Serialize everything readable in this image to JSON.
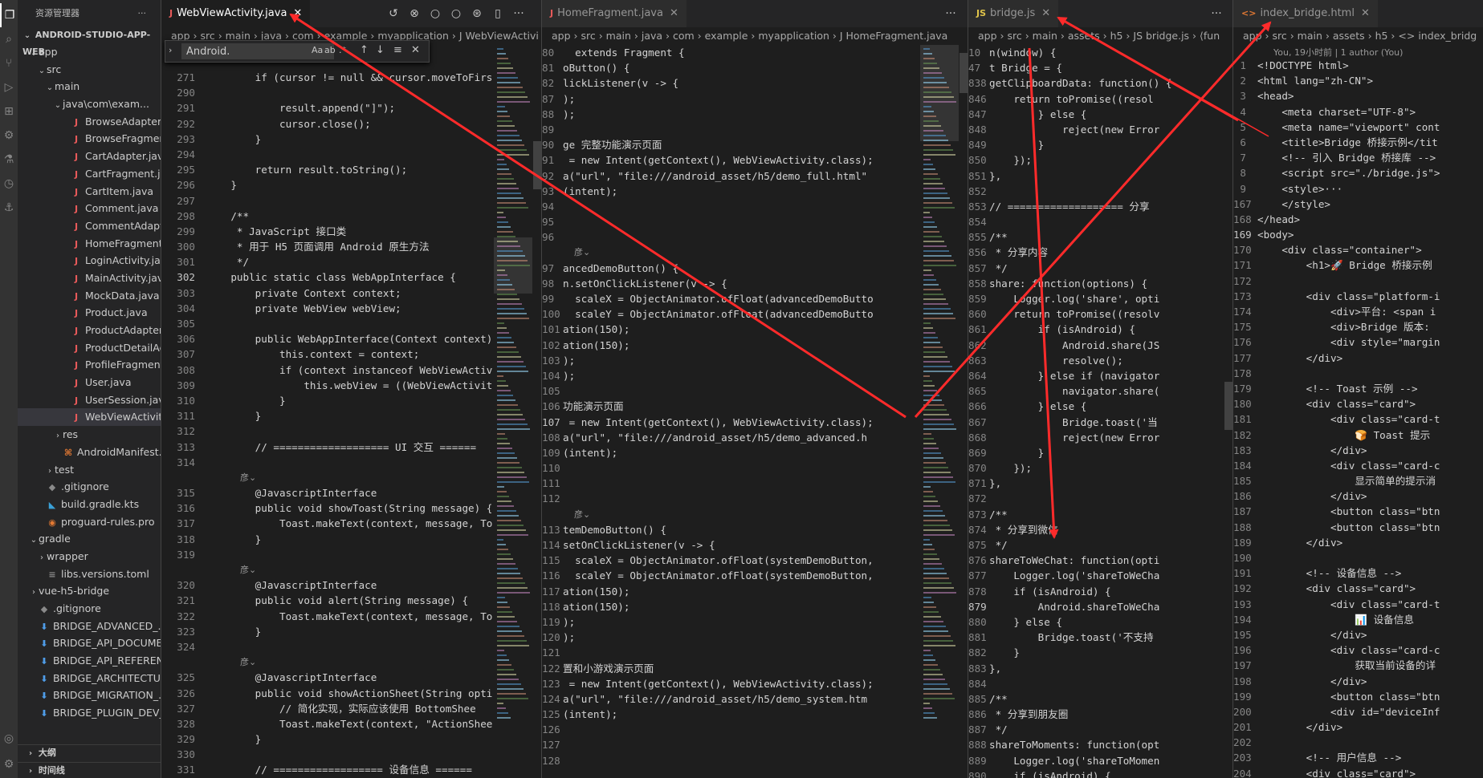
{
  "explorer": {
    "title": "资源管理器",
    "more": "···",
    "root": "ANDROID-STUDIO-APP-WEB",
    "items": [
      {
        "depth": 1,
        "chev": "⌄",
        "icon": "",
        "label": "app"
      },
      {
        "depth": 2,
        "chev": "⌄",
        "icon": "",
        "label": "src"
      },
      {
        "depth": 3,
        "chev": "⌄",
        "icon": "",
        "label": "main"
      },
      {
        "depth": 4,
        "chev": "⌄",
        "icon": "",
        "label": "java\\com\\exam..."
      },
      {
        "depth": 5,
        "chev": "",
        "icon": "J",
        "label": "BrowseAdapter.j..."
      },
      {
        "depth": 5,
        "chev": "",
        "icon": "J",
        "label": "BrowseFragmen..."
      },
      {
        "depth": 5,
        "chev": "",
        "icon": "J",
        "label": "CartAdapter.java"
      },
      {
        "depth": 5,
        "chev": "",
        "icon": "J",
        "label": "CartFragment.java"
      },
      {
        "depth": 5,
        "chev": "",
        "icon": "J",
        "label": "CartItem.java"
      },
      {
        "depth": 5,
        "chev": "",
        "icon": "J",
        "label": "Comment.java"
      },
      {
        "depth": 5,
        "chev": "",
        "icon": "J",
        "label": "CommentAdapt..."
      },
      {
        "depth": 5,
        "chev": "",
        "icon": "J",
        "label": "HomeFragment...."
      },
      {
        "depth": 5,
        "chev": "",
        "icon": "J",
        "label": "LoginActivity.java"
      },
      {
        "depth": 5,
        "chev": "",
        "icon": "J",
        "label": "MainActivity.java"
      },
      {
        "depth": 5,
        "chev": "",
        "icon": "J",
        "label": "MockData.java"
      },
      {
        "depth": 5,
        "chev": "",
        "icon": "J",
        "label": "Product.java"
      },
      {
        "depth": 5,
        "chev": "",
        "icon": "J",
        "label": "ProductAdapter...."
      },
      {
        "depth": 5,
        "chev": "",
        "icon": "J",
        "label": "ProductDetailAc..."
      },
      {
        "depth": 5,
        "chev": "",
        "icon": "J",
        "label": "ProfileFragment...."
      },
      {
        "depth": 5,
        "chev": "",
        "icon": "J",
        "label": "User.java"
      },
      {
        "depth": 5,
        "chev": "",
        "icon": "J",
        "label": "UserSession.java"
      },
      {
        "depth": 5,
        "chev": "",
        "icon": "J",
        "label": "WebViewActivit...",
        "selected": true
      },
      {
        "depth": 4,
        "chev": "›",
        "icon": "",
        "label": "res"
      },
      {
        "depth": 4,
        "chev": "",
        "icon": "⌘",
        "label": "AndroidManifest..."
      },
      {
        "depth": 3,
        "chev": "›",
        "icon": "",
        "label": "test"
      },
      {
        "depth": 2,
        "chev": "",
        "icon": "◆",
        "label": ".gitignore"
      },
      {
        "depth": 2,
        "chev": "",
        "icon": "◣",
        "label": "build.gradle.kts"
      },
      {
        "depth": 2,
        "chev": "",
        "icon": "◉",
        "label": "proguard-rules.pro"
      },
      {
        "depth": 1,
        "chev": "⌄",
        "icon": "",
        "label": "gradle"
      },
      {
        "depth": 2,
        "chev": "›",
        "icon": "",
        "label": "wrapper"
      },
      {
        "depth": 2,
        "chev": "",
        "icon": "≡",
        "label": "libs.versions.toml"
      },
      {
        "depth": 1,
        "chev": "›",
        "icon": "",
        "label": "vue-h5-bridge"
      },
      {
        "depth": 1,
        "chev": "",
        "icon": "◆",
        "label": ".gitignore"
      },
      {
        "depth": 1,
        "chev": "",
        "icon": "⬇",
        "label": "BRIDGE_ADVANCED_..."
      },
      {
        "depth": 1,
        "chev": "",
        "icon": "⬇",
        "label": "BRIDGE_API_DOCUME..."
      },
      {
        "depth": 1,
        "chev": "",
        "icon": "⬇",
        "label": "BRIDGE_API_REFEREN..."
      },
      {
        "depth": 1,
        "chev": "",
        "icon": "⬇",
        "label": "BRIDGE_ARCHITECTU..."
      },
      {
        "depth": 1,
        "chev": "",
        "icon": "⬇",
        "label": "BRIDGE_MIGRATION_..."
      },
      {
        "depth": 1,
        "chev": "",
        "icon": "⬇",
        "label": "BRIDGE_PLUGIN_DEV_..."
      }
    ],
    "outline": "大纲",
    "timeline": "时间线"
  },
  "editor1": {
    "tab_icon": "J",
    "tab": "WebViewActivity.java",
    "close": "✕",
    "actions": [
      "↺",
      "⊗",
      "○",
      "○",
      "⊛",
      "▯",
      "···"
    ],
    "breadcrumb": "app  ›  src  ›  main  ›  java  ›  com  ›  example  ›  myapplication  ›  J  WebViewActivi",
    "find_value": "Android.",
    "find_opts": [
      "Aa",
      "ab",
      ".*"
    ],
    "find_buttons": [
      "↑",
      "↓",
      "≡",
      "✕"
    ],
    "lines": [
      {
        "n": "271",
        "t": "        if (cursor != null && cursor.moveToFirs"
      },
      {
        "n": "290",
        "t": ""
      },
      {
        "n": "291",
        "t": "            result.append(\"]\");"
      },
      {
        "n": "292",
        "t": "            cursor.close();"
      },
      {
        "n": "293",
        "t": "        }"
      },
      {
        "n": "294",
        "t": ""
      },
      {
        "n": "295",
        "t": "        return result.toString();"
      },
      {
        "n": "296",
        "t": "    }"
      },
      {
        "n": "297",
        "t": ""
      },
      {
        "n": "298",
        "t": "    /**"
      },
      {
        "n": "299",
        "t": "     * JavaScript 接口类"
      },
      {
        "n": "300",
        "t": "     * 用于 H5 页面调用 Android 原生方法"
      },
      {
        "n": "301",
        "t": "     */"
      },
      {
        "n": "302",
        "t": "    public static class WebAppInterface {",
        "cur": true
      },
      {
        "n": "303",
        "t": "        private Context context;"
      },
      {
        "n": "304",
        "t": "        private WebView webView;"
      },
      {
        "n": "305",
        "t": ""
      },
      {
        "n": "306",
        "t": "        public WebAppInterface(Context context)"
      },
      {
        "n": "307",
        "t": "            this.context = context;"
      },
      {
        "n": "308",
        "t": "            if (context instanceof WebViewActiv"
      },
      {
        "n": "309",
        "t": "                this.webView = ((WebViewActivit"
      },
      {
        "n": "310",
        "t": "            }"
      },
      {
        "n": "311",
        "t": "        }"
      },
      {
        "n": "312",
        "t": ""
      },
      {
        "n": "313",
        "t": "        // =================== UI 交互 ======"
      },
      {
        "n": "314",
        "t": ""
      },
      {
        "n": "",
        "lens": "        彦⌄"
      },
      {
        "n": "315",
        "t": "        @JavascriptInterface"
      },
      {
        "n": "316",
        "t": "        public void showToast(String message) {"
      },
      {
        "n": "317",
        "t": "            Toast.makeText(context, message, To"
      },
      {
        "n": "318",
        "t": "        }"
      },
      {
        "n": "319",
        "t": ""
      },
      {
        "n": "",
        "lens": "        彦⌄"
      },
      {
        "n": "320",
        "t": "        @JavascriptInterface"
      },
      {
        "n": "321",
        "t": "        public void alert(String message) {"
      },
      {
        "n": "322",
        "t": "            Toast.makeText(context, message, To"
      },
      {
        "n": "323",
        "t": "        }"
      },
      {
        "n": "324",
        "t": ""
      },
      {
        "n": "",
        "lens": "        彦⌄"
      },
      {
        "n": "325",
        "t": "        @JavascriptInterface"
      },
      {
        "n": "326",
        "t": "        public void showActionSheet(String opti"
      },
      {
        "n": "327",
        "t": "            // 简化实现，实际应该使用 BottomShee"
      },
      {
        "n": "328",
        "t": "            Toast.makeText(context, \"ActionShee"
      },
      {
        "n": "329",
        "t": "        }"
      },
      {
        "n": "330",
        "t": ""
      },
      {
        "n": "331",
        "t": "        // ================== 设备信息 ======"
      },
      {
        "n": "332",
        "t": ""
      }
    ]
  },
  "editor2": {
    "tab_icon": "J",
    "tab": "HomeFragment.java",
    "close": "✕",
    "more": "···",
    "breadcrumb": "app  ›  src  ›  main  ›  java  ›  com  ›  example  ›  myapplication  ›  J  HomeFragment.java",
    "lines": [
      {
        "n": "80",
        "t": "  extends Fragment {"
      },
      {
        "n": "81",
        "t": "oButton() {"
      },
      {
        "n": "82",
        "t": "lickListener(v -> {"
      },
      {
        "n": "87",
        "t": ");"
      },
      {
        "n": "88",
        "t": ");"
      },
      {
        "n": "89",
        "t": ""
      },
      {
        "n": "90",
        "t": "ge 完整功能演示页面"
      },
      {
        "n": "91",
        "t": " = new Intent(getContext(), WebViewActivity.class);"
      },
      {
        "n": "92",
        "t": "a(\"url\", \"file:///android_asset/h5/demo_full.html\""
      },
      {
        "n": "93",
        "t": "(intent);"
      },
      {
        "n": "94",
        "t": ""
      },
      {
        "n": "95",
        "t": ""
      },
      {
        "n": "96",
        "t": ""
      },
      {
        "n": "",
        "lens": "彦⌄"
      },
      {
        "n": "97",
        "t": "ancedDemoButton() {"
      },
      {
        "n": "98",
        "t": "n.setOnClickListener(v -> {"
      },
      {
        "n": "99",
        "t": "  scaleX = ObjectAnimator.ofFloat(advancedDemoButto"
      },
      {
        "n": "100",
        "t": "  scaleY = ObjectAnimator.ofFloat(advancedDemoButto"
      },
      {
        "n": "101",
        "t": "ation(150);"
      },
      {
        "n": "102",
        "t": "ation(150);"
      },
      {
        "n": "103",
        "t": ");"
      },
      {
        "n": "104",
        "t": ");"
      },
      {
        "n": "105",
        "t": ""
      },
      {
        "n": "106",
        "t": "功能演示页面"
      },
      {
        "n": "107",
        "t": " = new Intent(getContext(), WebViewActivity.class);",
        "cur": true
      },
      {
        "n": "108",
        "t": "a(\"url\", \"file:///android_asset/h5/demo_advanced.h"
      },
      {
        "n": "109",
        "t": "(intent);"
      },
      {
        "n": "110",
        "t": ""
      },
      {
        "n": "111",
        "t": ""
      },
      {
        "n": "112",
        "t": ""
      },
      {
        "n": "",
        "lens": "彦⌄"
      },
      {
        "n": "113",
        "t": "temDemoButton() {"
      },
      {
        "n": "114",
        "t": "setOnClickListener(v -> {"
      },
      {
        "n": "115",
        "t": "  scaleX = ObjectAnimator.ofFloat(systemDemoButton,"
      },
      {
        "n": "116",
        "t": "  scaleY = ObjectAnimator.ofFloat(systemDemoButton,"
      },
      {
        "n": "117",
        "t": "ation(150);"
      },
      {
        "n": "118",
        "t": "ation(150);"
      },
      {
        "n": "119",
        "t": ");"
      },
      {
        "n": "120",
        "t": ");"
      },
      {
        "n": "121",
        "t": ""
      },
      {
        "n": "122",
        "t": "置和小游戏演示页面"
      },
      {
        "n": "123",
        "t": " = new Intent(getContext(), WebViewActivity.class);"
      },
      {
        "n": "124",
        "t": "a(\"url\", \"file:///android_asset/h5/demo_system.htm"
      },
      {
        "n": "125",
        "t": "(intent);"
      },
      {
        "n": "126",
        "t": ""
      },
      {
        "n": "127",
        "t": ""
      },
      {
        "n": "128",
        "t": ""
      }
    ]
  },
  "editor3": {
    "tab_icon": "JS",
    "tab": "bridge.js",
    "close": "✕",
    "more": "···",
    "breadcrumb": "app  ›  src  ›  main  ›  assets  ›  h5  ›  JS  bridge.js  ›  ⟨fun",
    "lines": [
      {
        "n": "10",
        "t": "n(window) {"
      },
      {
        "n": "47",
        "t": "t Bridge = {"
      },
      {
        "n": "838",
        "t": "getClipboardData: function() {"
      },
      {
        "n": "846",
        "t": "    return toPromise((resol"
      },
      {
        "n": "847",
        "t": "        } else {"
      },
      {
        "n": "848",
        "t": "            reject(new Error"
      },
      {
        "n": "849",
        "t": "        }"
      },
      {
        "n": "850",
        "t": "    });"
      },
      {
        "n": "851",
        "t": "},"
      },
      {
        "n": "852",
        "t": ""
      },
      {
        "n": "853",
        "t": "// =================== 分享"
      },
      {
        "n": "854",
        "t": ""
      },
      {
        "n": "855",
        "t": "/**"
      },
      {
        "n": "856",
        "t": " * 分享内容"
      },
      {
        "n": "857",
        "t": " */"
      },
      {
        "n": "858",
        "t": "share: function(options) {"
      },
      {
        "n": "859",
        "t": "    Logger.log('share', opti"
      },
      {
        "n": "860",
        "t": "    return toPromise((resolv"
      },
      {
        "n": "861",
        "t": "        if (isAndroid) {"
      },
      {
        "n": "862",
        "t": "            Android.share(JS"
      },
      {
        "n": "863",
        "t": "            resolve();"
      },
      {
        "n": "864",
        "t": "        } else if (navigator"
      },
      {
        "n": "865",
        "t": "            navigator.share("
      },
      {
        "n": "866",
        "t": "        } else {"
      },
      {
        "n": "867",
        "t": "            Bridge.toast('当"
      },
      {
        "n": "868",
        "t": "            reject(new Error"
      },
      {
        "n": "869",
        "t": "        }"
      },
      {
        "n": "870",
        "t": "    });"
      },
      {
        "n": "871",
        "t": "},"
      },
      {
        "n": "872",
        "t": ""
      },
      {
        "n": "873",
        "t": "/**"
      },
      {
        "n": "874",
        "t": " * 分享到微信"
      },
      {
        "n": "875",
        "t": " */"
      },
      {
        "n": "876",
        "t": "shareToWeChat: function(opti"
      },
      {
        "n": "877",
        "t": "    Logger.log('shareToWeCha"
      },
      {
        "n": "878",
        "t": "    if (isAndroid) {"
      },
      {
        "n": "879",
        "t": "        Android.shareToWeCha",
        "cur": true
      },
      {
        "n": "880",
        "t": "    } else {"
      },
      {
        "n": "881",
        "t": "        Bridge.toast('不支持"
      },
      {
        "n": "882",
        "t": "    }"
      },
      {
        "n": "883",
        "t": "},"
      },
      {
        "n": "884",
        "t": ""
      },
      {
        "n": "885",
        "t": "/**"
      },
      {
        "n": "886",
        "t": " * 分享到朋友圈"
      },
      {
        "n": "887",
        "t": " */"
      },
      {
        "n": "888",
        "t": "shareToMoments: function(opt"
      },
      {
        "n": "889",
        "t": "    Logger.log('shareToMomen"
      },
      {
        "n": "890",
        "t": "    if (isAndroid) {"
      }
    ]
  },
  "editor4": {
    "tab_icon": "<>",
    "tab": "index_bridge.html",
    "close": "✕",
    "breadcrumb": "app  ›  src  ›  main  ›  assets  ›  h5  ›  <>  index_bridg",
    "blame": "You, 19小时前 | 1 author (You)",
    "lines": [
      {
        "n": "1",
        "t": "<!DOCTYPE html>"
      },
      {
        "n": "2",
        "t": "<html lang=\"zh-CN\">"
      },
      {
        "n": "3",
        "t": "<head>"
      },
      {
        "n": "4",
        "t": "    <meta charset=\"UTF-8\">"
      },
      {
        "n": "5",
        "t": "    <meta name=\"viewport\" cont"
      },
      {
        "n": "6",
        "t": "    <title>Bridge 桥接示例</tit"
      },
      {
        "n": "7",
        "t": "    <!-- 引入 Bridge 桥接库 -->"
      },
      {
        "n": "8",
        "t": "    <script src=\"./bridge.js\">"
      },
      {
        "n": "9",
        "t": "    <style>···",
        "fold": true
      },
      {
        "n": "167",
        "t": "    </style>"
      },
      {
        "n": "168",
        "t": "</head>"
      },
      {
        "n": "169",
        "t": "<body>",
        "cur": true
      },
      {
        "n": "170",
        "t": "    <div class=\"container\">"
      },
      {
        "n": "171",
        "t": "        <h1>🚀 Bridge 桥接示例"
      },
      {
        "n": "172",
        "t": ""
      },
      {
        "n": "173",
        "t": "        <div class=\"platform-i"
      },
      {
        "n": "174",
        "t": "            <div>平台: <span i"
      },
      {
        "n": "175",
        "t": "            <div>Bridge 版本:"
      },
      {
        "n": "176",
        "t": "            <div style=\"margin"
      },
      {
        "n": "177",
        "t": "        </div>"
      },
      {
        "n": "178",
        "t": ""
      },
      {
        "n": "179",
        "t": "        <!-- Toast 示例 -->"
      },
      {
        "n": "180",
        "t": "        <div class=\"card\">"
      },
      {
        "n": "181",
        "t": "            <div class=\"card-t"
      },
      {
        "n": "182",
        "t": "                🍞 Toast 提示"
      },
      {
        "n": "183",
        "t": "            </div>"
      },
      {
        "n": "184",
        "t": "            <div class=\"card-c"
      },
      {
        "n": "185",
        "t": "                显示简单的提示消"
      },
      {
        "n": "186",
        "t": "            </div>"
      },
      {
        "n": "187",
        "t": "            <button class=\"btn"
      },
      {
        "n": "188",
        "t": "            <button class=\"btn"
      },
      {
        "n": "189",
        "t": "        </div>"
      },
      {
        "n": "190",
        "t": ""
      },
      {
        "n": "191",
        "t": "        <!-- 设备信息 -->"
      },
      {
        "n": "192",
        "t": "        <div class=\"card\">"
      },
      {
        "n": "193",
        "t": "            <div class=\"card-t"
      },
      {
        "n": "194",
        "t": "                📊 设备信息"
      },
      {
        "n": "195",
        "t": "            </div>"
      },
      {
        "n": "196",
        "t": "            <div class=\"card-c"
      },
      {
        "n": "197",
        "t": "                获取当前设备的详"
      },
      {
        "n": "198",
        "t": "            </div>"
      },
      {
        "n": "199",
        "t": "            <button class=\"btn"
      },
      {
        "n": "200",
        "t": "            <div id=\"deviceInf"
      },
      {
        "n": "201",
        "t": "        </div>"
      },
      {
        "n": "202",
        "t": ""
      },
      {
        "n": "203",
        "t": "        <!-- 用户信息 -->"
      },
      {
        "n": "204",
        "t": "        <div class=\"card\">"
      }
    ]
  },
  "colors": {
    "background": "#1e1e1e",
    "sidebar": "#252526",
    "activity_bar": "#333333",
    "annotation": "#ff2b2b"
  }
}
